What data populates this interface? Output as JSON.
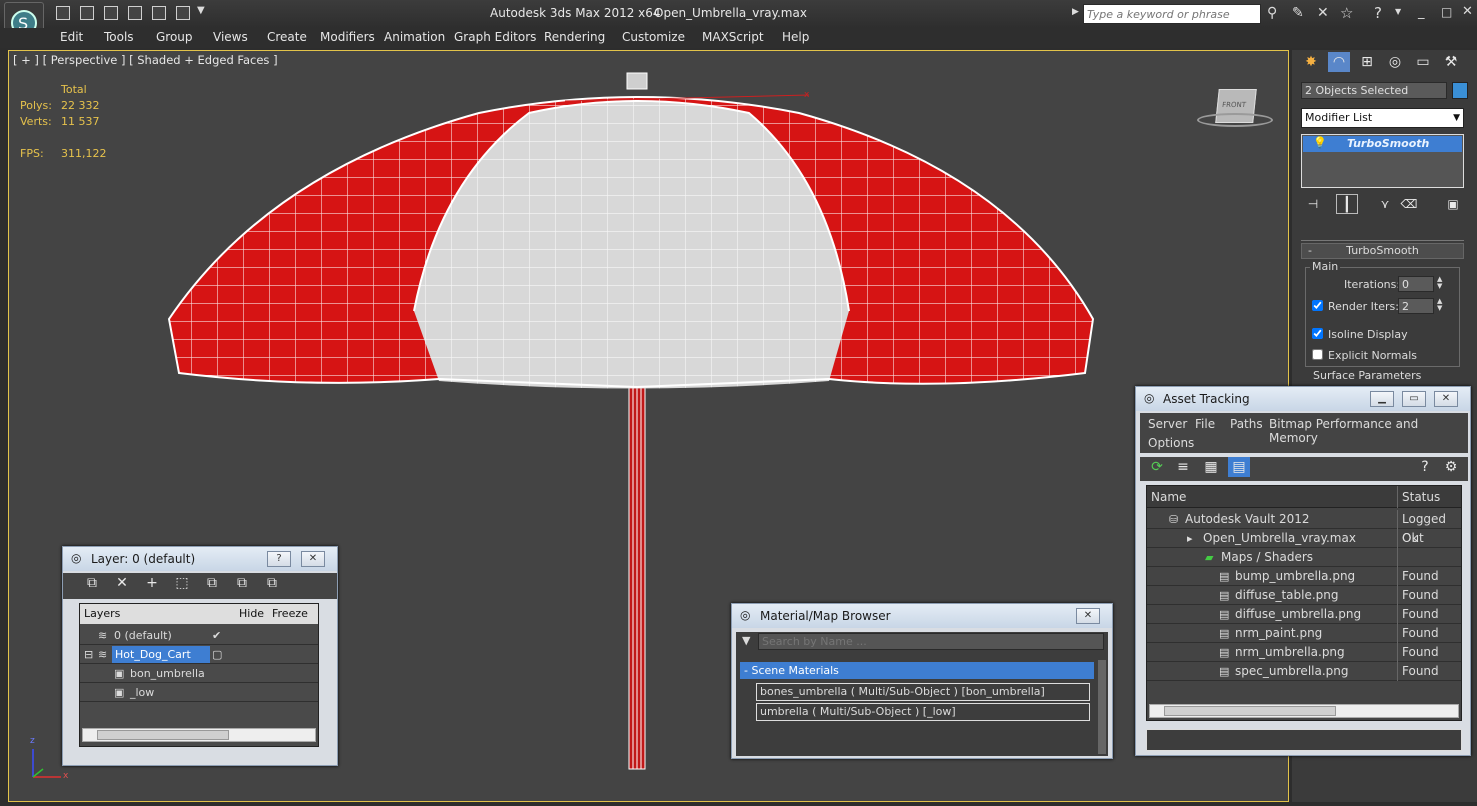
{
  "app": {
    "title": "Autodesk 3ds Max  2012 x64",
    "file": "Open_Umbrella_vray.max",
    "search_placeholder": "Type a keyword or phrase"
  },
  "menu": [
    "Edit",
    "Tools",
    "Group",
    "Views",
    "Create",
    "Modifiers",
    "Animation",
    "Graph Editors",
    "Rendering",
    "Customize",
    "MAXScript",
    "Help"
  ],
  "viewport": {
    "label": "[ + ] [ Perspective ] [ Shaded + Edged Faces ]",
    "stats": {
      "total_label": "Total",
      "polys_label": "Polys:",
      "polys": "22 332",
      "verts_label": "Verts:",
      "verts": "11 537",
      "fps_label": "FPS:",
      "fps": "311,122"
    },
    "viewcube_label": "FRONT",
    "colors": {
      "canopy_red": "#d61414",
      "canopy_white": "#d8d8d8",
      "background": "#444444"
    }
  },
  "command_panel": {
    "selection": "2 Objects Selected",
    "modifier_list": "Modifier List",
    "stack_item": "TurboSmooth",
    "rollout_title": "TurboSmooth",
    "main_label": "Main",
    "iterations_label": "Iterations:",
    "iterations": "0",
    "render_iters_label": "Render Iters:",
    "render_iters": "2",
    "isoline_label": "Isoline Display",
    "explicit_label": "Explicit Normals",
    "surface_label": "Surface Parameters",
    "render_iters_checked": true,
    "isoline_checked": true,
    "explicit_checked": false
  },
  "layer_dialog": {
    "title": "Layer: 0 (default)",
    "columns": [
      "Layers",
      "Hide",
      "Freeze"
    ],
    "rows": [
      {
        "name": "0 (default)"
      },
      {
        "name": "Hot_Dog_Cart"
      },
      {
        "name": "bon_umbrella"
      },
      {
        "name": "_low"
      }
    ]
  },
  "material_browser": {
    "title": "Material/Map Browser",
    "search_placeholder": "Search by Name ...",
    "section": "- Scene Materials",
    "items": [
      "bones_umbrella  ( Multi/Sub-Object ) [bon_umbrella]",
      "umbrella  ( Multi/Sub-Object ) [_low]"
    ]
  },
  "asset_tracking": {
    "title": "Asset Tracking",
    "menu": [
      "Server",
      "File",
      "Paths",
      "Bitmap Performance and Memory",
      "Options"
    ],
    "columns": [
      "Name",
      "Status"
    ],
    "rows": [
      {
        "name": "Autodesk Vault 2012",
        "status": "Logged Out"
      },
      {
        "name": "Open_Umbrella_vray.max",
        "status": "Ok"
      },
      {
        "name": "Maps / Shaders",
        "status": ""
      },
      {
        "name": "bump_umbrella.png",
        "status": "Found"
      },
      {
        "name": "diffuse_table.png",
        "status": "Found"
      },
      {
        "name": "diffuse_umbrella.png",
        "status": "Found"
      },
      {
        "name": "nrm_paint.png",
        "status": "Found"
      },
      {
        "name": "nrm_umbrella.png",
        "status": "Found"
      },
      {
        "name": "spec_umbrella.png",
        "status": "Found"
      }
    ]
  },
  "axis_labels": {
    "z": "z",
    "x": "x"
  }
}
